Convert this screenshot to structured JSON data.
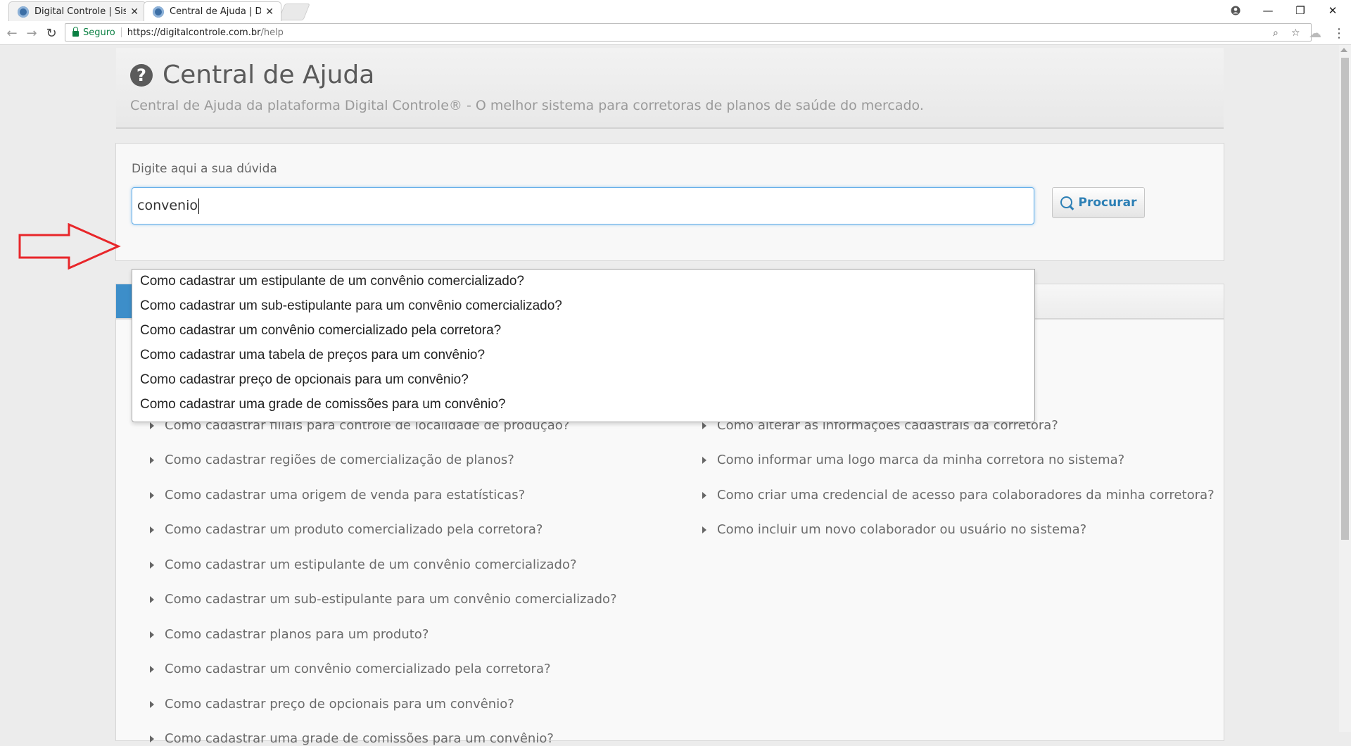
{
  "browser": {
    "tabs": [
      {
        "title": "Digital Controle | Sistema",
        "active": false
      },
      {
        "title": "Central de Ajuda | Digital",
        "active": true
      }
    ],
    "address": {
      "secure_label": "Seguro",
      "url_host": "https://digitalcontrole.com.br",
      "url_path": "/help"
    },
    "window_controls": {
      "minimize": "—",
      "restore": "❐",
      "close": "✕"
    }
  },
  "header": {
    "title": "Central de Ajuda",
    "subtitle": "Central de Ajuda da plataforma Digital Controle® - O melhor sistema para corretoras de planos de saúde do mercado."
  },
  "search": {
    "label": "Digite aqui a sua dúvida",
    "value": "convenio",
    "button_label": "Procurar",
    "suggestions": [
      "Como cadastrar um estipulante de um convênio comercializado?",
      "Como cadastrar um sub-estipulante para um convênio comercializado?",
      "Como cadastrar um convênio comercializado pela corretora?",
      "Como cadastrar uma tabela de preços para um convênio?",
      "Como cadastrar preço de opcionais para um convênio?",
      "Como cadastrar uma grade de comissões para um convênio?"
    ]
  },
  "faq": {
    "left": [
      "Como cadastrar filiais para controle de localidade de produção?",
      "Como cadastrar regiões de comercialização de planos?",
      "Como cadastrar uma origem de venda para estatísticas?",
      "Como cadastrar um produto comercializado pela corretora?",
      "Como cadastrar um estipulante de um convênio comercializado?",
      "Como cadastrar um sub-estipulante para um convênio comercializado?",
      "Como cadastrar planos para um produto?",
      "Como cadastrar um convênio comercializado pela corretora?",
      "Como cadastrar preço de opcionais para um convênio?",
      "Como cadastrar uma grade de comissões para um convênio?"
    ],
    "right": [
      "Como alterar as informações cadastrais da corretora?",
      "Como informar uma logo marca da minha corretora no sistema?",
      "Como criar uma credencial de acesso para colaboradores da minha corretora?",
      "Como incluir um novo colaborador ou usuário no sistema?"
    ]
  },
  "colors": {
    "accent": "#3d8ec9",
    "annotation_arrow": "#e8262a",
    "secure_green": "#0b8043"
  }
}
